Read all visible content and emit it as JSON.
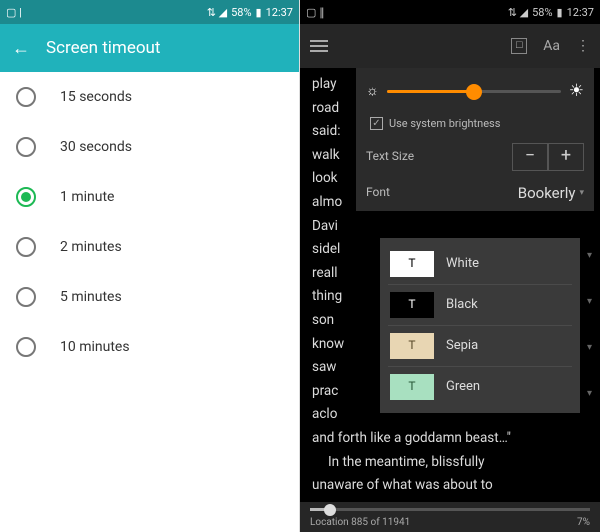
{
  "status": {
    "left_icons_left": "▢ |",
    "icons_right": "⇅ ◢ 58% ▮ 12:37",
    "right_icons_left": "▢ ∥",
    "battery_pct": "58%",
    "time": "12:37"
  },
  "left": {
    "header_title": "Screen timeout",
    "options": [
      {
        "label": "15 seconds",
        "selected": false
      },
      {
        "label": "30 seconds",
        "selected": false
      },
      {
        "label": "1 minute",
        "selected": true
      },
      {
        "label": "2 minutes",
        "selected": false
      },
      {
        "label": "5 minutes",
        "selected": false
      },
      {
        "label": "10 minutes",
        "selected": false
      }
    ]
  },
  "right": {
    "toolbar": {
      "aa": "Aa"
    },
    "reader_text_partial": [
      "play",
      "road",
      "said:",
      "walk",
      "look",
      "almo",
      "Davi",
      "sidel",
      "reall",
      "thing",
      "son",
      "know",
      "saw",
      "prac",
      "aclo",
      "and forth like a goddamn beast…\"",
      "In the meantime, blissfully",
      "unaware of what was about to"
    ],
    "panel": {
      "use_system_brightness": "Use system brightness",
      "text_size_label": "Text Size",
      "font_label": "Font",
      "font_value": "Bookerly",
      "brightness_value_pct": 50
    },
    "themes": [
      {
        "name": "White",
        "swatch_bg": "#ffffff",
        "swatch_fg": "#000000"
      },
      {
        "name": "Black",
        "swatch_bg": "#000000",
        "swatch_fg": "#ffffff"
      },
      {
        "name": "Sepia",
        "swatch_bg": "#e8d6b3",
        "swatch_fg": "#5a4a2a"
      },
      {
        "name": "Green",
        "swatch_bg": "#a8e0c0",
        "swatch_fg": "#2a5a3a"
      }
    ],
    "footer": {
      "location": "Location 885 of 11941",
      "percent": "7%"
    }
  }
}
